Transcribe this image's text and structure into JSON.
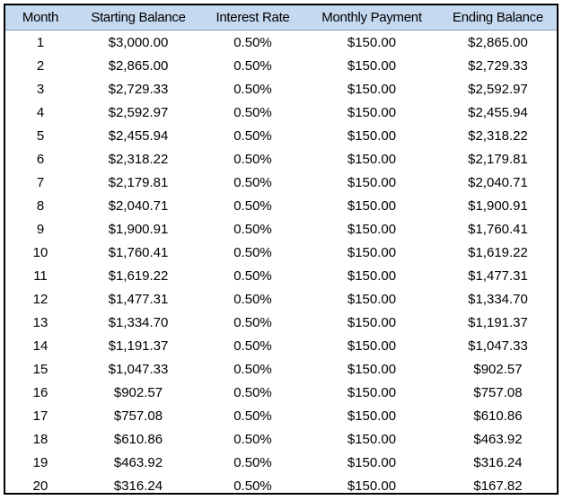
{
  "colors": {
    "header_bg": "#c5d9f1",
    "border": "#000000"
  },
  "table": {
    "headers": [
      "Month",
      "Starting Balance",
      "Interest Rate",
      "Monthly Payment",
      "Ending Balance"
    ],
    "rows": [
      [
        "1",
        "$3,000.00",
        "0.50%",
        "$150.00",
        "$2,865.00"
      ],
      [
        "2",
        "$2,865.00",
        "0.50%",
        "$150.00",
        "$2,729.33"
      ],
      [
        "3",
        "$2,729.33",
        "0.50%",
        "$150.00",
        "$2,592.97"
      ],
      [
        "4",
        "$2,592.97",
        "0.50%",
        "$150.00",
        "$2,455.94"
      ],
      [
        "5",
        "$2,455.94",
        "0.50%",
        "$150.00",
        "$2,318.22"
      ],
      [
        "6",
        "$2,318.22",
        "0.50%",
        "$150.00",
        "$2,179.81"
      ],
      [
        "7",
        "$2,179.81",
        "0.50%",
        "$150.00",
        "$2,040.71"
      ],
      [
        "8",
        "$2,040.71",
        "0.50%",
        "$150.00",
        "$1,900.91"
      ],
      [
        "9",
        "$1,900.91",
        "0.50%",
        "$150.00",
        "$1,760.41"
      ],
      [
        "10",
        "$1,760.41",
        "0.50%",
        "$150.00",
        "$1,619.22"
      ],
      [
        "11",
        "$1,619.22",
        "0.50%",
        "$150.00",
        "$1,477.31"
      ],
      [
        "12",
        "$1,477.31",
        "0.50%",
        "$150.00",
        "$1,334.70"
      ],
      [
        "13",
        "$1,334.70",
        "0.50%",
        "$150.00",
        "$1,191.37"
      ],
      [
        "14",
        "$1,191.37",
        "0.50%",
        "$150.00",
        "$1,047.33"
      ],
      [
        "15",
        "$1,047.33",
        "0.50%",
        "$150.00",
        "$902.57"
      ],
      [
        "16",
        "$902.57",
        "0.50%",
        "$150.00",
        "$757.08"
      ],
      [
        "17",
        "$757.08",
        "0.50%",
        "$150.00",
        "$610.86"
      ],
      [
        "18",
        "$610.86",
        "0.50%",
        "$150.00",
        "$463.92"
      ],
      [
        "19",
        "$463.92",
        "0.50%",
        "$150.00",
        "$316.24"
      ],
      [
        "20",
        "$316.24",
        "0.50%",
        "$150.00",
        "$167.82"
      ]
    ]
  }
}
